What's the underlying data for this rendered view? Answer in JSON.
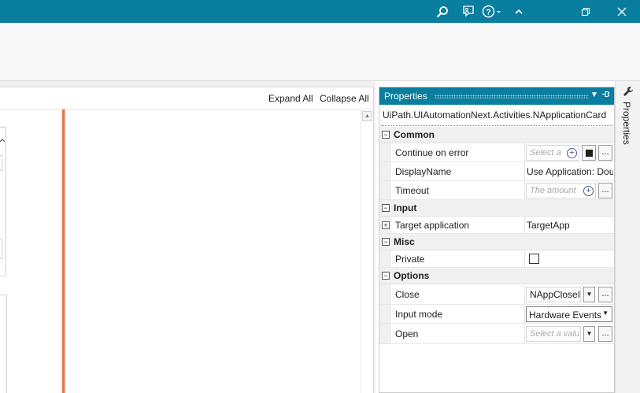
{
  "titlebar": {
    "icons": [
      "search-icon",
      "feedback-icon",
      "help-icon",
      "collapse-ribbon-icon",
      "restore-icon",
      "close-icon"
    ]
  },
  "designer": {
    "expand_all": "Expand All",
    "collapse_all": "Collapse All"
  },
  "properties": {
    "title": "Properties",
    "type_name": "UiPath.UIAutomationNext.Activities.NApplicationCard",
    "categories": {
      "common": "Common",
      "input": "Input",
      "misc": "Misc",
      "options": "Options"
    },
    "rows": {
      "continue_on_error": {
        "name": "Continue on error",
        "placeholder": "Select a"
      },
      "display_name": {
        "name": "DisplayName",
        "value": "Use Application: Dou"
      },
      "timeout": {
        "name": "Timeout",
        "placeholder": "The amount"
      },
      "target_application": {
        "name": "Target application",
        "value": "TargetApp"
      },
      "private": {
        "name": "Private",
        "checked": false
      },
      "close": {
        "name": "Close",
        "value": "NAppCloseI"
      },
      "input_mode": {
        "name": "Input mode",
        "value": "Hardware Events"
      },
      "open": {
        "name": "Open",
        "placeholder": "Select a valu"
      }
    },
    "dots_label": "...",
    "expand_glyph": "⊟",
    "collapse_glyph": "+"
  },
  "dock": {
    "label": "Properties"
  },
  "colors": {
    "accent": "#0a7e9e",
    "canvas_rule": "#e8744e"
  }
}
